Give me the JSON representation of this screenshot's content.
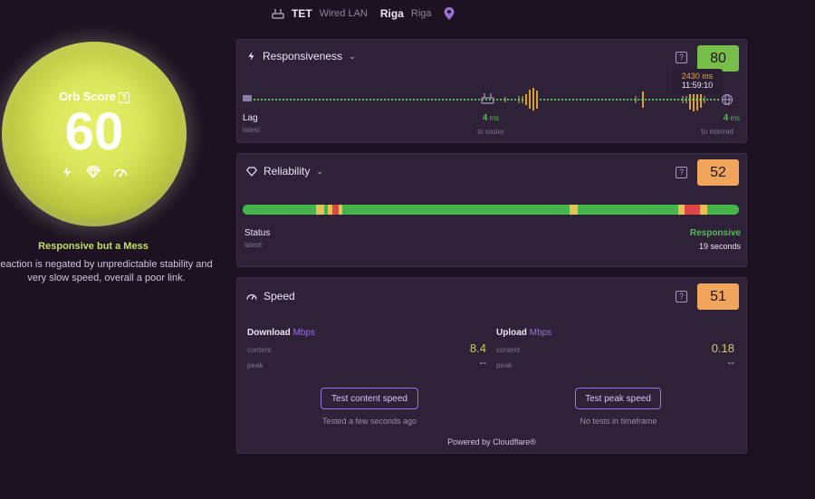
{
  "topbar": {
    "isp": "TET",
    "connection": "Wired LAN",
    "city": "Riga",
    "region": "Riga"
  },
  "orb": {
    "title": "Orb Score",
    "score": "60",
    "verdict": "Responsive but a Mess",
    "description": "eaction is negated by unpredictable stability and very slow speed, overall a poor link."
  },
  "responsiveness": {
    "title": "Responsiveness",
    "score": "80",
    "score_color": "#77bd4a",
    "lag_label": "Lag",
    "lag_sub": "latest",
    "router_value": "4",
    "router_unit": "ms",
    "router_label": "to router",
    "internet_value": "4",
    "internet_unit": "ms",
    "internet_label": "to internet",
    "tooltip_value": "2430 ms",
    "tooltip_time": "11:59:10"
  },
  "reliability": {
    "title": "Reliability",
    "score": "52",
    "score_color": "#f0a55a",
    "status_label": "Status",
    "status_sub": "latest",
    "status_value": "Responsive",
    "status_time": "19 seconds"
  },
  "speed": {
    "title": "Speed",
    "score": "51",
    "score_color": "#f0a55a",
    "download_label": "Download",
    "upload_label": "Upload",
    "unit": "Mbps",
    "content_label": "content",
    "peak_label": "peak",
    "download_content": "8.4",
    "download_peak": "--",
    "upload_content": "0.18",
    "upload_peak": "--",
    "btn_content": "Test content speed",
    "btn_peak": "Test peak speed",
    "content_status": "Tested a few seconds ago",
    "peak_status": "No tests in timeframe",
    "powered": "Powered by Cloudflare®"
  }
}
